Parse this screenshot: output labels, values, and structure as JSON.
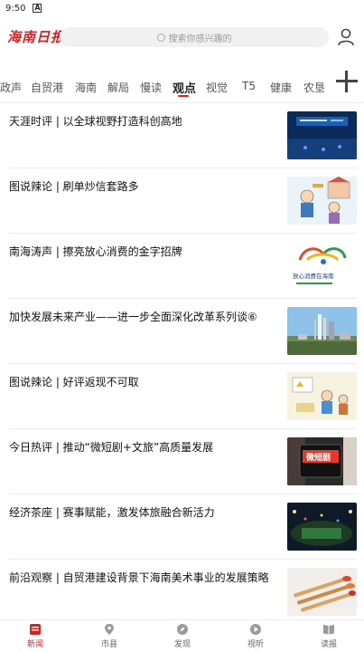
{
  "status_bar": {
    "time": "9:50",
    "notification_icon": "A"
  },
  "header": {
    "logo_text": "海南日报",
    "search_placeholder": "搜索你感兴趣的",
    "user_icon": "user-icon"
  },
  "tabs": [
    {
      "label": "政声"
    },
    {
      "label": "自贸港"
    },
    {
      "label": "海南"
    },
    {
      "label": "解局"
    },
    {
      "label": "慢读"
    },
    {
      "label": "观点",
      "active": true
    },
    {
      "label": "视觉"
    },
    {
      "label": "T5"
    },
    {
      "label": "健康"
    },
    {
      "label": "农垦"
    }
  ],
  "news": [
    {
      "title": "天涯时评 | 以全球视野打造科创高地",
      "thumb": "tech-conference"
    },
    {
      "title": "图说辣论 | 刷单炒信套路多",
      "thumb": "cartoon-fraud"
    },
    {
      "title": "南海涛声 | 擦亮放心消费的金字招牌",
      "thumb": "consumer-logo",
      "thumb_text": "放心消费在海南"
    },
    {
      "title": "加快发展未来产业——进一步全面深化改革系列谈⑥",
      "thumb": "rocket-launch"
    },
    {
      "title": "图说辣论 | 好评返现不可取",
      "thumb": "cartoon-review"
    },
    {
      "title": "今日热评 | 推动“微短剧+文旅”高质量发展",
      "thumb": "short-drama",
      "thumb_text": "微短剧"
    },
    {
      "title": "经济茶座 | 赛事赋能，激发体旅融合新活力",
      "thumb": "stadium-night"
    },
    {
      "title": "前沿观察 | 自贸港建设背景下海南美术事业的发展策略",
      "thumb": "paint-brushes"
    }
  ],
  "bottom_nav": [
    {
      "label": "新闻",
      "icon": "news-icon",
      "active": true
    },
    {
      "label": "市县",
      "icon": "location-icon"
    },
    {
      "label": "发现",
      "icon": "discover-icon"
    },
    {
      "label": "视听",
      "icon": "play-icon"
    },
    {
      "label": "读报",
      "icon": "book-icon"
    }
  ],
  "colors": {
    "brand": "#d81e1e",
    "tab_underline": "#e02020"
  }
}
